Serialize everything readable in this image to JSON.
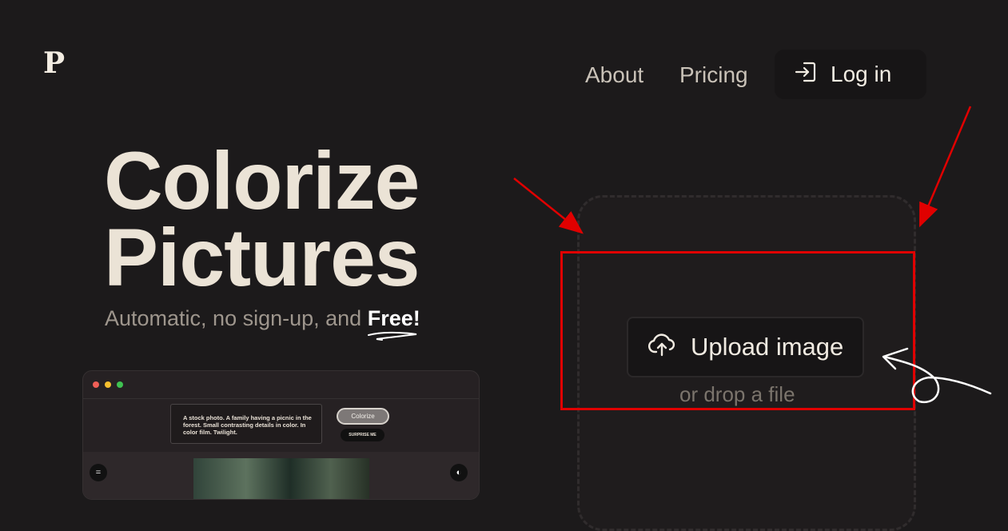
{
  "header": {
    "logo": "P",
    "nav": {
      "about": "About",
      "pricing": "Pricing"
    },
    "login_label": "Log in"
  },
  "hero": {
    "title_line1": "Colorize",
    "title_line2": "Pictures",
    "subtitle": "Automatic, no sign-up, and ",
    "subtitle_emphasis": "Free!"
  },
  "preview": {
    "prompt_text": "A stock photo. A family having a picnic in the forest. Small contrasting details in color. In color film. Twilight.",
    "colorize_label": "Colorize",
    "surprise_label": "SURPRISE ME",
    "menu_icon": "menu-icon",
    "palette_icon": "palette-icon"
  },
  "upload": {
    "button_label": "Upload image",
    "drop_text": "or drop a file",
    "icon": "cloud-upload-icon"
  },
  "colors": {
    "background": "#1c1a1b",
    "annotation_red": "#e00000"
  }
}
